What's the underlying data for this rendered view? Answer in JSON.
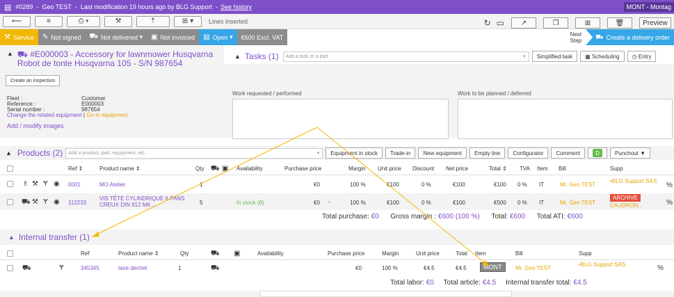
{
  "titlebar": {
    "doc_number": "#0289",
    "separator1": "-",
    "client": "Geo TEST",
    "separator2": "-",
    "modification": "Last modification 19 hours ago by BLG Support",
    "separator3": "-",
    "history_link": "See history",
    "mont": "MONT - Montag"
  },
  "toolbar": {
    "lines_inserted": "Lines inserted",
    "preview": "Preview"
  },
  "status": {
    "service": "Service",
    "not_signed": "Not signed",
    "not_delivered": "Not delivered",
    "not_invoiced": "Not invoiced",
    "open": "Open",
    "amount": "€600 Excl. VAT",
    "next_step": "Next",
    "next_step2": "Step",
    "create_delivery": "Create a delivery order"
  },
  "equipment": {
    "title": "#E000003 - Accessory for lawnmower Husqvarna Robot de tonte Husqvarna 105 - S/N 987654",
    "inspection_button": "Create an inspection",
    "fleet_k": "Fleet :",
    "fleet_v": "Customer",
    "ref_k": "Reference :",
    "ref_v": "E000003",
    "serial_k": "Serial number :",
    "serial_v": "987654",
    "change_link": "Change the related equipment",
    "sep": "|",
    "goto_link": "Go to equipment",
    "add_images": "Add / modify images"
  },
  "tasks": {
    "title": "Tasks (1)",
    "placeholder": "Add a task or a part",
    "simplified": "Simplified task",
    "scheduling": "Scheduling",
    "entry": "Entry",
    "work_requested": "Work requested / performed",
    "work_planned": "Work to be planned / deferred"
  },
  "products": {
    "title": "Products (2)",
    "placeholder": "Add a product, part, equipment, etc.",
    "buttons": [
      "Equipment in stock",
      "Trade-in",
      "New equipment",
      "Empty line",
      "Configurator",
      "Comment"
    ],
    "d_badge": "D",
    "punchout": "Punchout",
    "headers": {
      "ref": "Ref ⇕",
      "name": "Product name ⇕",
      "qty": "Qty",
      "availability": "Availability",
      "purchase": "Purchase price",
      "margin": "Margin",
      "unit": "Unit price",
      "discount": "Discount",
      "net": "Net price",
      "total": "Total ⇕",
      "tva": "TVA",
      "item": "Item",
      "bill": "Bill",
      "supp": "Supp"
    },
    "rows": [
      {
        "ref": "0001",
        "name": "MO Atelier",
        "qty": "1",
        "availability": "",
        "purchase": "€0",
        "margin": "100 %",
        "unit": "€100",
        "discount": "0 %",
        "net": "€100",
        "total": "€100",
        "tva": "0 %",
        "item": "IT",
        "bill": "Mr. Geo TEST",
        "supp": "•BLG Support SAS",
        "pct": "%"
      },
      {
        "ref": "112233",
        "name": "VIS TÊTE CYLINDRIQUE 6 PANS CREUX DIN 912 M6 ...",
        "qty": "5",
        "availability": "In stock (8)",
        "purchase": "€0",
        "margin": "100 %",
        "unit": "€100",
        "discount": "0 %",
        "net": "€100",
        "total": "€500",
        "tva": "0 %",
        "item": "IT",
        "bill": "Mr. Geo TEST",
        "supp_badge": "ARCHIVE",
        "supp": "CAUDRON...",
        "pct": "%"
      }
    ],
    "totals": {
      "purchase_label": "Total purchase:",
      "purchase": "€0",
      "gross_label": "Gross margin :",
      "gross": "€600 (100 %)",
      "total_label": "Total:",
      "total": "€600",
      "ati_label": "Total ATI:",
      "ati": "€600"
    }
  },
  "internal": {
    "title": "Internal transfer (1)",
    "headers": {
      "ref": "Ref",
      "name": "Product name ⇕",
      "qty": "Qty",
      "availability": "Availability",
      "purchase": "Purchase price",
      "margin": "Margin",
      "unit": "Unit price",
      "total": "Total",
      "item": "Item",
      "bill": "Bill",
      "supp": "Supp"
    },
    "row": {
      "ref": "345345",
      "name": "taxe dechet",
      "qty": "1",
      "purchase": "€0",
      "margin": "100 %",
      "unit": "€4.5",
      "total": "€4.5",
      "item": "MONT",
      "bill": "Mr. Geo TEST",
      "supp": "•BLG Support SAS",
      "pct": "%"
    },
    "totals": {
      "labor_label": "Total labor:",
      "labor": "€0",
      "article_label": "Total article:",
      "article": "€4.5",
      "transfer_label": "Internal transfer total:",
      "transfer": "€4.5"
    }
  },
  "colors": {
    "purple": "#7e4fc9",
    "yellow": "#f2b705",
    "blue": "#37a6e6",
    "grey": "#8c8c8c",
    "green": "#67bb4d",
    "orange": "#e8a200"
  }
}
